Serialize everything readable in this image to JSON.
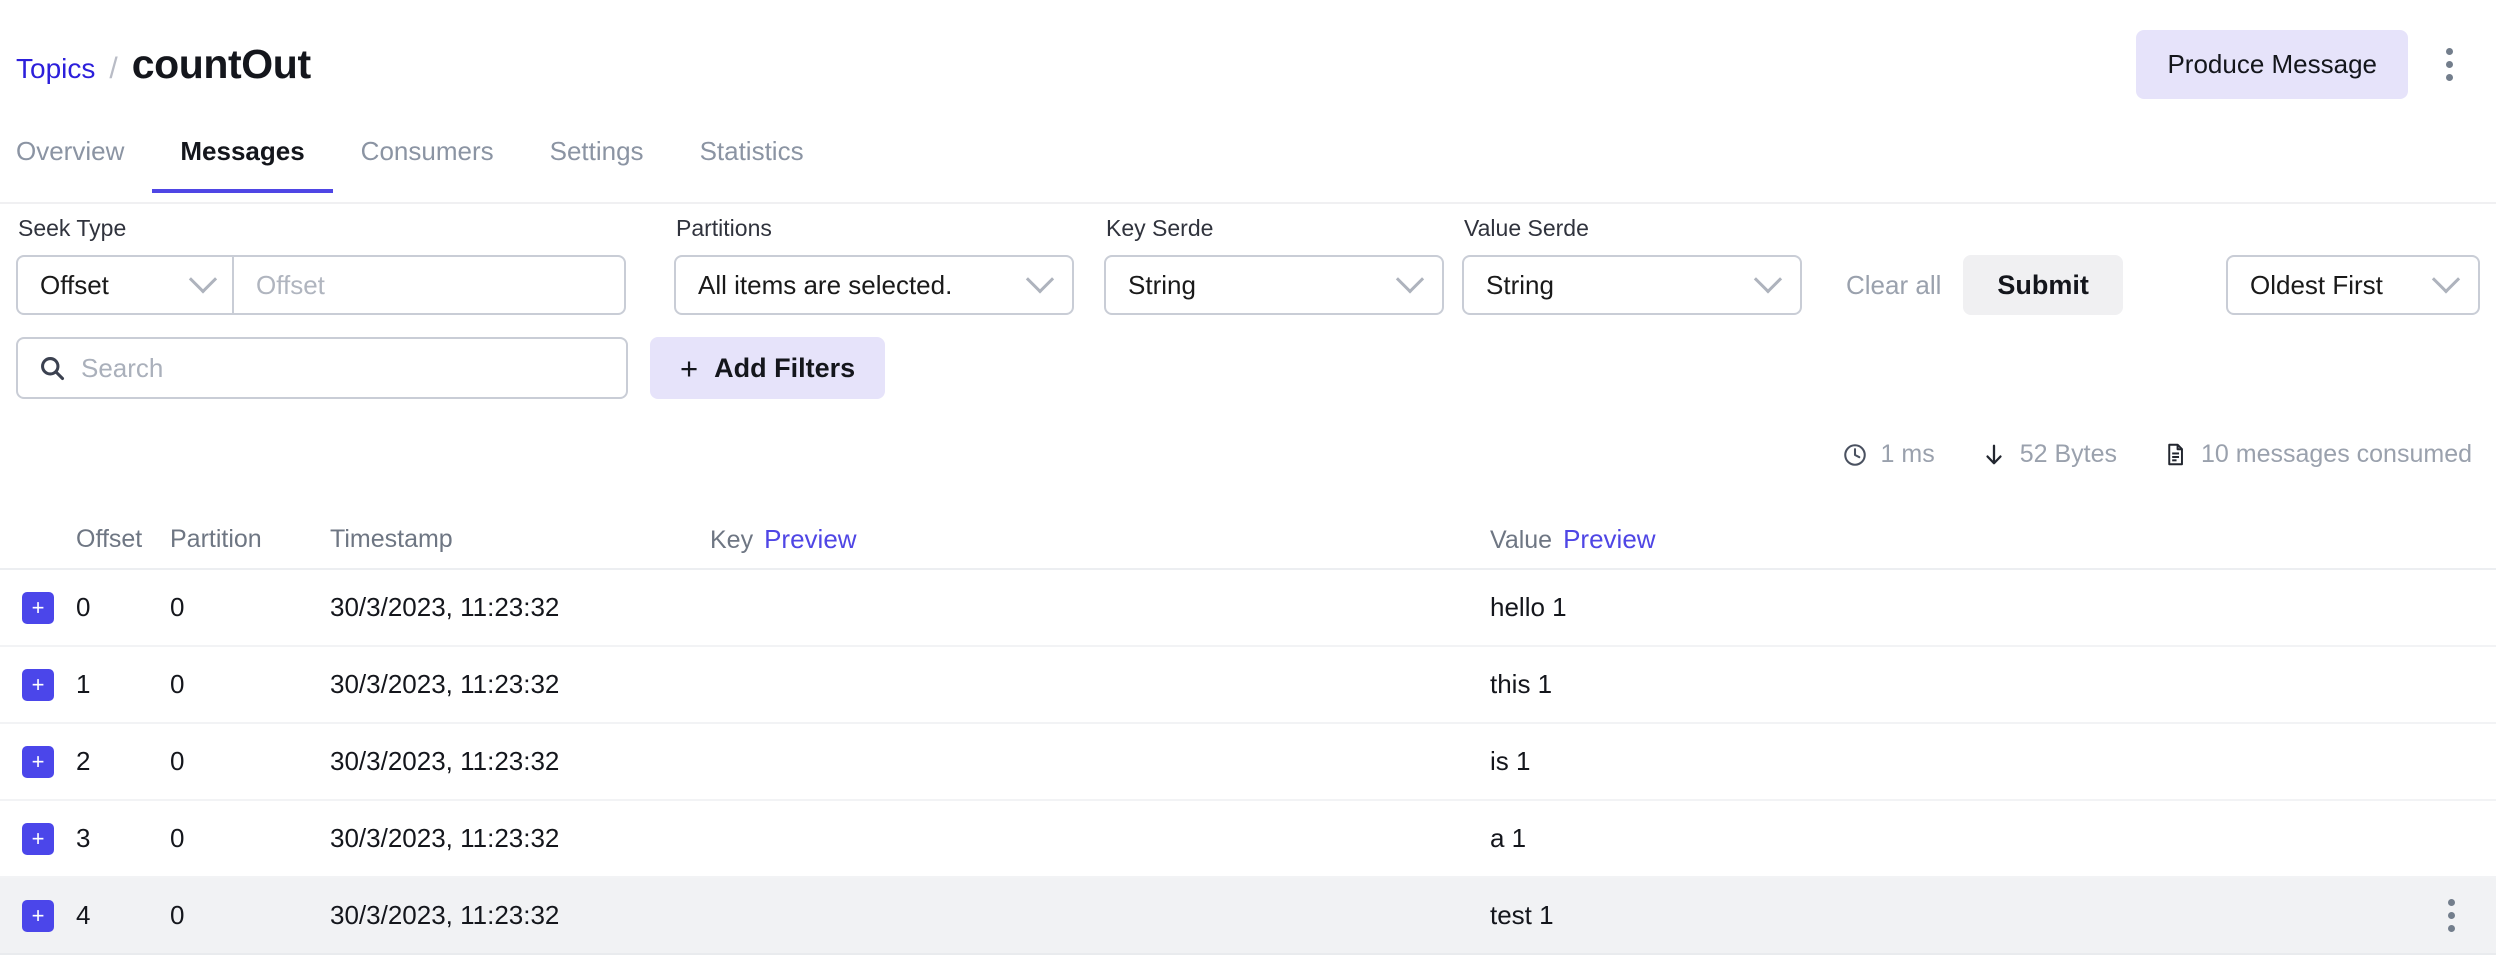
{
  "header": {
    "breadcrumb_parent": "Topics",
    "breadcrumb_sep": "/",
    "title": "countOut",
    "produce_button": "Produce Message"
  },
  "tabs": [
    {
      "label": "Overview",
      "active": false
    },
    {
      "label": "Messages",
      "active": true
    },
    {
      "label": "Consumers",
      "active": false
    },
    {
      "label": "Settings",
      "active": false
    },
    {
      "label": "Statistics",
      "active": false
    }
  ],
  "filters": {
    "seek_type_label": "Seek Type",
    "seek_type_value": "Offset",
    "seek_offset_placeholder": "Offset",
    "seek_offset_value": "",
    "partitions_label": "Partitions",
    "partitions_value": "All items are selected.",
    "key_serde_label": "Key Serde",
    "key_serde_value": "String",
    "value_serde_label": "Value Serde",
    "value_serde_value": "String",
    "clear_all_label": "Clear all",
    "submit_label": "Submit",
    "sort_value": "Oldest First",
    "search_placeholder": "Search",
    "search_value": "",
    "add_filters_label": "Add Filters",
    "add_filters_plus": "+"
  },
  "stats": {
    "elapsed": "1 ms",
    "size": "52 Bytes",
    "consumed": "10 messages consumed"
  },
  "table": {
    "columns": {
      "offset": "Offset",
      "partition": "Partition",
      "timestamp": "Timestamp",
      "key": "Key",
      "key_preview": "Preview",
      "value": "Value",
      "value_preview": "Preview"
    },
    "rows": [
      {
        "expand": "+",
        "offset": "0",
        "partition": "0",
        "timestamp": "30/3/2023, 11:23:32",
        "key": "",
        "value": "hello 1",
        "hovered": false
      },
      {
        "expand": "+",
        "offset": "1",
        "partition": "0",
        "timestamp": "30/3/2023, 11:23:32",
        "key": "",
        "value": "this 1",
        "hovered": false
      },
      {
        "expand": "+",
        "offset": "2",
        "partition": "0",
        "timestamp": "30/3/2023, 11:23:32",
        "key": "",
        "value": "is 1",
        "hovered": false
      },
      {
        "expand": "+",
        "offset": "3",
        "partition": "0",
        "timestamp": "30/3/2023, 11:23:32",
        "key": "",
        "value": "a 1",
        "hovered": false
      },
      {
        "expand": "+",
        "offset": "4",
        "partition": "0",
        "timestamp": "30/3/2023, 11:23:32",
        "key": "",
        "value": "test 1",
        "hovered": true
      }
    ]
  },
  "colors": {
    "accent": "#4f46e5",
    "accent_button": "#4b46ea",
    "accent_soft": "#e6e3fa",
    "link": "#2c1fdb",
    "muted": "#9aa1ad",
    "row_hover": "#f1f2f4",
    "button_grey": "#f0f0f2"
  },
  "icons": {
    "search": "search-icon",
    "clock": "clock-icon",
    "download": "download-arrow-icon",
    "document": "document-icon",
    "kebab": "more-vertical-icon",
    "chevron": "chevron-down-icon"
  }
}
